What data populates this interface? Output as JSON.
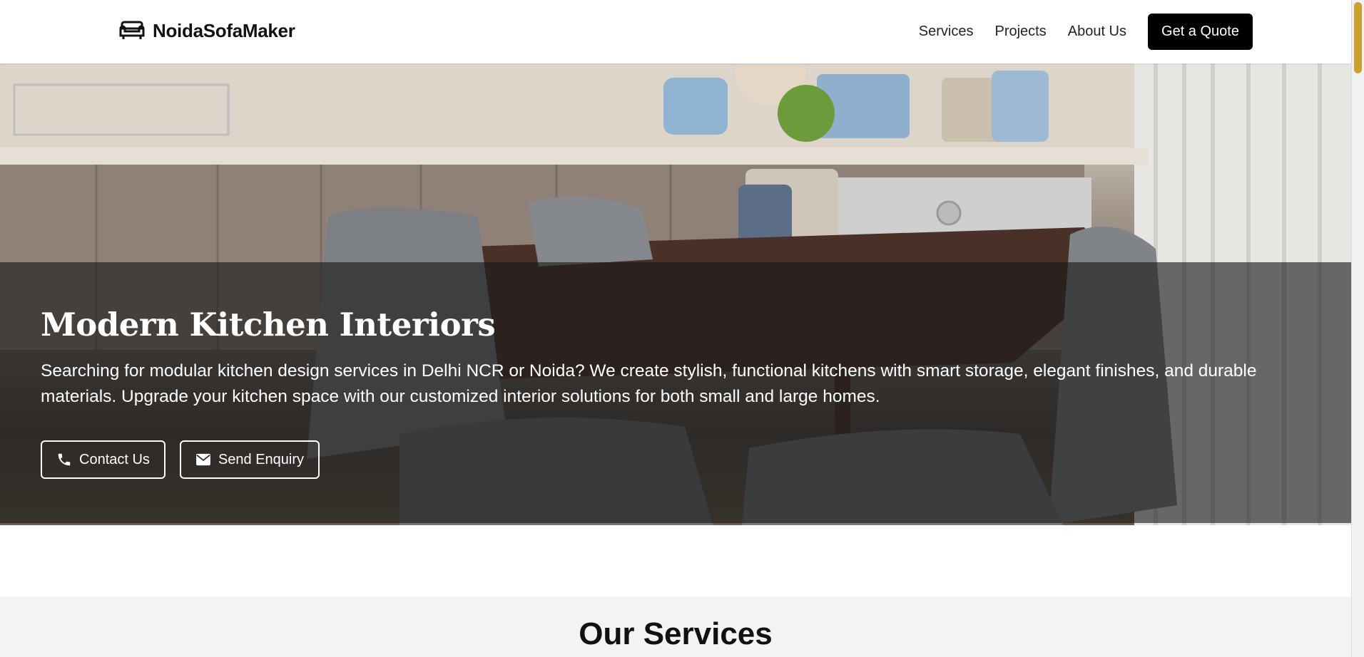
{
  "header": {
    "brand_name": "NoidaSofaMaker",
    "nav": {
      "services": "Services",
      "projects": "Projects",
      "about": "About Us"
    },
    "quote_button": "Get a Quote"
  },
  "hero": {
    "title": "Modern Kitchen Interiors",
    "description": "Searching for modular kitchen design services in Delhi NCR or Noida? We create stylish, functional kitchens with smart storage, elegant finishes, and durable materials. Upgrade your kitchen space with our customized interior solutions for both small and large homes.",
    "contact_button": "Contact Us",
    "enquiry_button": "Send Enquiry"
  },
  "services": {
    "title": "Our Services"
  },
  "colors": {
    "accent": "#000000",
    "overlay": "#191919",
    "section_bg": "#f2f3f5"
  },
  "icons": [
    "sofa-icon",
    "phone-icon",
    "mail-icon"
  ]
}
